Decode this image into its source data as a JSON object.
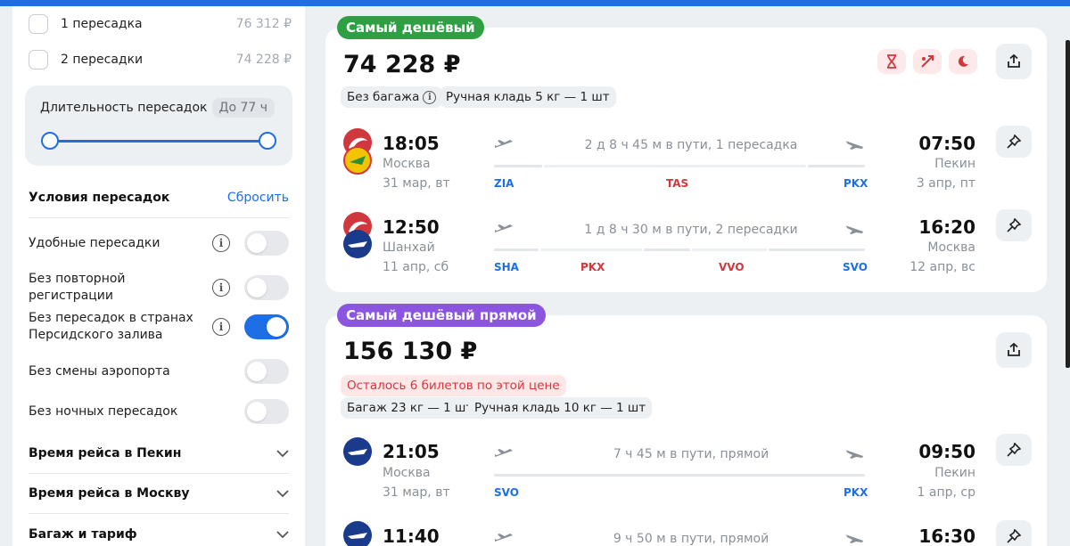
{
  "sidebar": {
    "stops": [
      {
        "label": "1 пересадка",
        "price": "76 312 ₽"
      },
      {
        "label": "2 пересадки",
        "price": "74 228 ₽"
      }
    ],
    "duration": {
      "label": "Длительность пересадок",
      "value": "До 77 ч"
    },
    "conditions": {
      "title": "Условия пересадок",
      "reset": "Сбросить",
      "toggles": [
        {
          "label": "Удобные пересадки",
          "on": false
        },
        {
          "label": "Без повторной регистрации",
          "on": false
        },
        {
          "label": "Без пересадок в странах Персидского залива",
          "on": true
        },
        {
          "label": "Без смены аэропорта",
          "on": false
        },
        {
          "label": "Без ночных пересадок",
          "on": false
        }
      ]
    },
    "sections": [
      {
        "label": "Время рейса в Пекин"
      },
      {
        "label": "Время рейса в Москву"
      },
      {
        "label": "Багаж и тариф"
      }
    ]
  },
  "cards": [
    {
      "badge": "Самый дешёвый",
      "badge_color": "#2ea043",
      "price": "74 228 ₽",
      "chips": [
        "Без багажа",
        "Ручная кладь 5 кг — 1 шт"
      ],
      "flights": [
        {
          "dep_time": "18:05",
          "dep_city": "Москва",
          "dep_date": "31 мар, вт",
          "duration": "2 д 8 ч 45 м в пути, 1 пересадка",
          "arr_time": "07:50",
          "arr_city": "Пекин",
          "arr_date": "3 апр, пт",
          "airports": [
            "ZIA",
            "TAS",
            "PKX"
          ]
        },
        {
          "dep_time": "12:50",
          "dep_city": "Шанхай",
          "dep_date": "11 апр, сб",
          "duration": "1 д 8 ч 30 м в пути, 2 пересадки",
          "arr_time": "16:20",
          "arr_city": "Москва",
          "arr_date": "12 апр, вс",
          "airports": [
            "SHA",
            "PKX",
            "VVO",
            "SVO"
          ]
        }
      ]
    },
    {
      "badge": "Самый дешёвый прямой",
      "badge_color": "#8b55e0",
      "price": "156 130 ₽",
      "warning": "Осталось 6 билетов по этой цене",
      "chips": [
        "Багаж 23 кг — 1 шт",
        "Ручная кладь 10 кг — 1 шт"
      ],
      "flights": [
        {
          "dep_time": "21:05",
          "dep_city": "Москва",
          "dep_date": "31 мар, вт",
          "duration": "7 ч 45 м в пути, прямой",
          "arr_time": "09:50",
          "arr_city": "Пекин",
          "arr_date": "1 апр, ср",
          "airports": [
            "SVO",
            "PKX"
          ]
        },
        {
          "dep_time": "11:40",
          "duration": "9 ч 50 м в пути, прямой",
          "arr_time": "16:30"
        }
      ]
    }
  ],
  "colors": {
    "accent": "#1e6fe6",
    "stopover": "#d0383e",
    "green_badge": "#2ea043",
    "purple_badge": "#8b55e0"
  }
}
